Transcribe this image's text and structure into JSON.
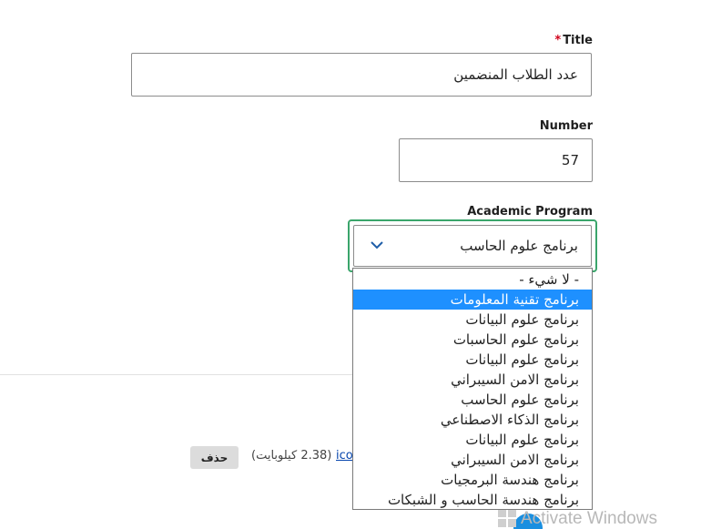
{
  "form": {
    "title": {
      "required_mark": "*",
      "label": "Title",
      "value": "عدد الطلاب المنضمين"
    },
    "number": {
      "label": "Number",
      "value": "57"
    },
    "academic_program": {
      "label": "Academic Program",
      "selected_value": "برنامج علوم الحاسب",
      "options": [
        "- لا شيء -",
        "برنامج تقنية المعلومات",
        "برنامج علوم البيانات",
        "برنامج علوم الحاسبات",
        "برنامج علوم البيانات",
        "برنامج الامن السيبراني",
        "برنامج علوم الحاسب",
        "برنامج الذكاء الاصطناعي",
        "برنامج علوم البيانات",
        "برنامج الامن السيبراني",
        "برنامج هندسة البرمجيات",
        "برنامج هندسة الحاسب و الشبكات"
      ],
      "highlighted_index": 1
    }
  },
  "attachment": {
    "delete_label": "حذف",
    "size_text": "(2.38 كيلوبايت)",
    "link_text": "ico"
  },
  "overlay": {
    "watermark_text": "Activate Windows"
  },
  "colors": {
    "focus_border": "#3aa56b",
    "highlight": "#1e90ff",
    "required": "#d0021b",
    "link": "#0645ad"
  }
}
